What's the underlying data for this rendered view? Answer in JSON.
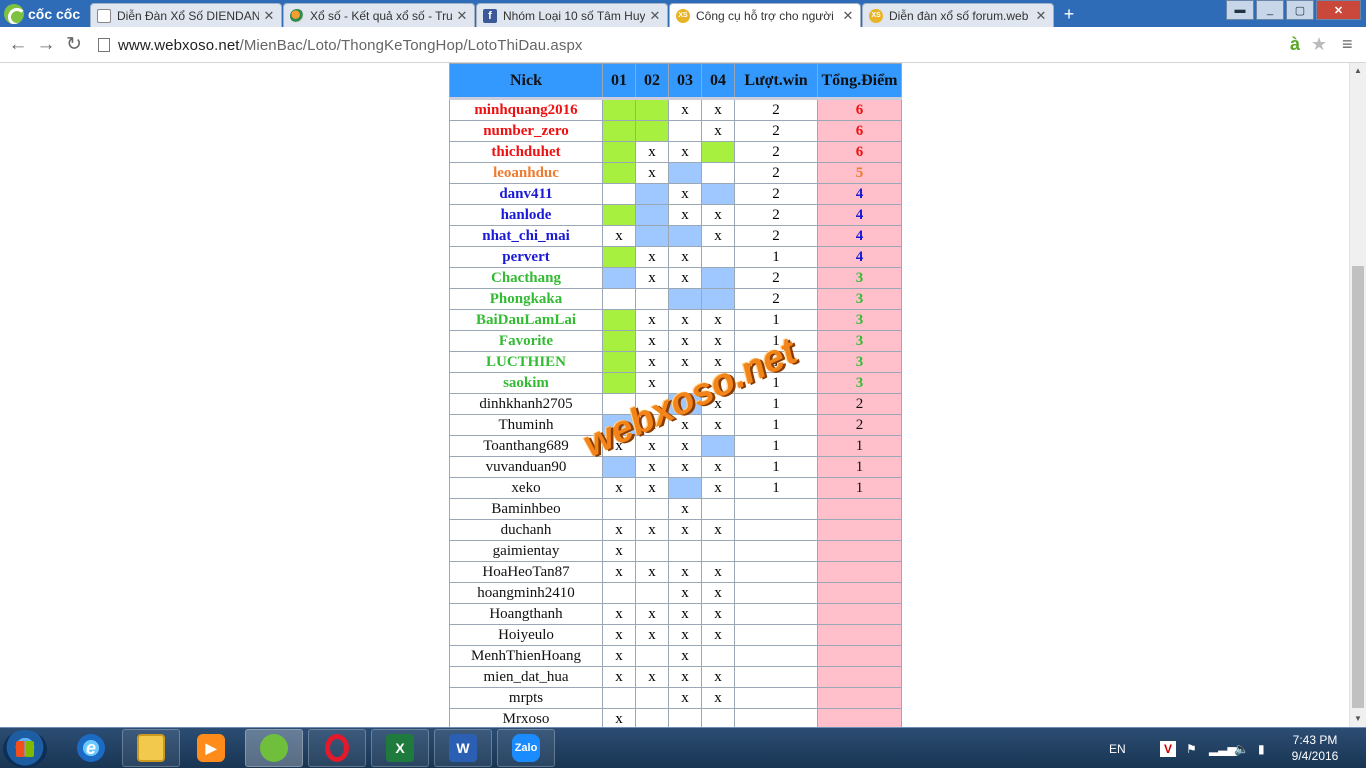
{
  "browser": {
    "brand": "cốc cốc",
    "tabs": [
      {
        "title": "Diễn Đàn Xổ Số DIENDAN",
        "favicon": "page-icon",
        "active": false
      },
      {
        "title": "Xổ số - Kết quả xổ số - Tru",
        "favicon": "globe-icon",
        "active": false
      },
      {
        "title": "Nhóm Loại 10 số Tâm Huy",
        "favicon": "facebook-icon",
        "active": false
      },
      {
        "title": "Công cụ hỗ trợ cho người",
        "favicon": "xs-icon",
        "active": true
      },
      {
        "title": "Diễn đàn xổ số forum.web",
        "favicon": "xs-icon",
        "active": false
      }
    ],
    "xs_label": "XS",
    "fb_label": "f",
    "url_host": "www.webxoso.net",
    "url_path": "/MienBac/Loto/ThongKeTongHop/LotoThiDau.aspx",
    "translate_glyph": "à"
  },
  "table": {
    "headers": {
      "nick": "Nick",
      "c1": "01",
      "c2": "02",
      "c3": "03",
      "c4": "04",
      "win": "Lượt.win",
      "score": "Tổng.Điểm"
    },
    "rows": [
      {
        "nick": "minhquang2016",
        "color": "red",
        "c": [
          "G",
          "G",
          "x",
          "x"
        ],
        "win": "2",
        "score": "6"
      },
      {
        "nick": "number_zero",
        "color": "red",
        "c": [
          "G",
          "G",
          "",
          "x"
        ],
        "win": "2",
        "score": "6"
      },
      {
        "nick": "thichduhet",
        "color": "red",
        "c": [
          "G",
          "x",
          "x",
          "G"
        ],
        "win": "2",
        "score": "6"
      },
      {
        "nick": "leoanhduc",
        "color": "orange",
        "c": [
          "G",
          "x",
          "B",
          ""
        ],
        "win": "2",
        "score": "5"
      },
      {
        "nick": "danv411",
        "color": "blue",
        "c": [
          "",
          "B",
          "x",
          "B"
        ],
        "win": "2",
        "score": "4"
      },
      {
        "nick": "hanlode",
        "color": "blue",
        "c": [
          "G",
          "B",
          "x",
          "x"
        ],
        "win": "2",
        "score": "4"
      },
      {
        "nick": "nhat_chi_mai",
        "color": "blue",
        "c": [
          "x",
          "B",
          "B",
          "x"
        ],
        "win": "2",
        "score": "4"
      },
      {
        "nick": "pervert",
        "color": "blue",
        "c": [
          "G",
          "x",
          "x",
          ""
        ],
        "win": "1",
        "score": "4"
      },
      {
        "nick": "Chacthang",
        "color": "green",
        "c": [
          "B",
          "x",
          "x",
          "B"
        ],
        "win": "2",
        "score": "3"
      },
      {
        "nick": "Phongkaka",
        "color": "green",
        "c": [
          "",
          "",
          "B",
          "B"
        ],
        "win": "2",
        "score": "3"
      },
      {
        "nick": "BaiDauLamLai",
        "color": "green",
        "c": [
          "G",
          "x",
          "x",
          "x"
        ],
        "win": "1",
        "score": "3"
      },
      {
        "nick": "Favorite",
        "color": "green",
        "c": [
          "G",
          "x",
          "x",
          "x"
        ],
        "win": "1",
        "score": "3"
      },
      {
        "nick": "LUCTHIEN",
        "color": "green",
        "c": [
          "G",
          "x",
          "x",
          "x"
        ],
        "win": "1",
        "score": "3"
      },
      {
        "nick": "saokim",
        "color": "green",
        "c": [
          "G",
          "x",
          "",
          "x"
        ],
        "win": "1",
        "score": "3"
      },
      {
        "nick": "dinhkhanh2705",
        "color": "normal",
        "c": [
          "",
          "",
          "B",
          "x"
        ],
        "win": "1",
        "score": "2"
      },
      {
        "nick": "Thuminh",
        "color": "normal",
        "c": [
          "B",
          "x",
          "x",
          "x"
        ],
        "win": "1",
        "score": "2"
      },
      {
        "nick": "Toanthang689",
        "color": "normal",
        "c": [
          "x",
          "x",
          "x",
          "B"
        ],
        "win": "1",
        "score": "1"
      },
      {
        "nick": "vuvanduan90",
        "color": "normal",
        "c": [
          "B",
          "x",
          "x",
          "x"
        ],
        "win": "1",
        "score": "1"
      },
      {
        "nick": "xeko",
        "color": "normal",
        "c": [
          "x",
          "x",
          "B",
          "x"
        ],
        "win": "1",
        "score": "1"
      },
      {
        "nick": "Baminhbeo",
        "color": "normal",
        "c": [
          "",
          "",
          "x",
          ""
        ],
        "win": "",
        "score": ""
      },
      {
        "nick": "duchanh",
        "color": "normal",
        "c": [
          "x",
          "x",
          "x",
          "x"
        ],
        "win": "",
        "score": ""
      },
      {
        "nick": "gaimientay",
        "color": "normal",
        "c": [
          "x",
          "",
          "",
          ""
        ],
        "win": "",
        "score": ""
      },
      {
        "nick": "HoaHeoTan87",
        "color": "normal",
        "c": [
          "x",
          "x",
          "x",
          "x"
        ],
        "win": "",
        "score": ""
      },
      {
        "nick": "hoangminh2410",
        "color": "normal",
        "c": [
          "",
          "",
          "x",
          "x"
        ],
        "win": "",
        "score": ""
      },
      {
        "nick": "Hoangthanh",
        "color": "normal",
        "c": [
          "x",
          "x",
          "x",
          "x"
        ],
        "win": "",
        "score": ""
      },
      {
        "nick": "Hoiyeulo",
        "color": "normal",
        "c": [
          "x",
          "x",
          "x",
          "x"
        ],
        "win": "",
        "score": ""
      },
      {
        "nick": "MenhThienHoang",
        "color": "normal",
        "c": [
          "x",
          "",
          "x",
          ""
        ],
        "win": "",
        "score": ""
      },
      {
        "nick": "mien_dat_hua",
        "color": "normal",
        "c": [
          "x",
          "x",
          "x",
          "x"
        ],
        "win": "",
        "score": ""
      },
      {
        "nick": "mrpts",
        "color": "normal",
        "c": [
          "",
          "",
          "x",
          "x"
        ],
        "win": "",
        "score": ""
      },
      {
        "nick": "Mrxoso",
        "color": "normal",
        "c": [
          "x",
          "",
          "",
          ""
        ],
        "win": "",
        "score": ""
      }
    ],
    "colors": {
      "green_cell": "#a8f040",
      "blue_cell": "#9ec8ff",
      "score_bg": "#ffc0cb",
      "header_bg": "#3399ff"
    }
  },
  "watermark": "webxoso.net",
  "taskbar": {
    "apps": [
      "internet-explorer",
      "file-explorer",
      "media-player",
      "coccoc-browser",
      "opera",
      "excel",
      "word",
      "zalo"
    ],
    "labels": {
      "excel": "X",
      "word": "W",
      "zalo": "Zalo",
      "opera": "",
      "ie": "e"
    },
    "lang": "EN",
    "time": "7:43 PM",
    "date": "9/4/2016"
  }
}
